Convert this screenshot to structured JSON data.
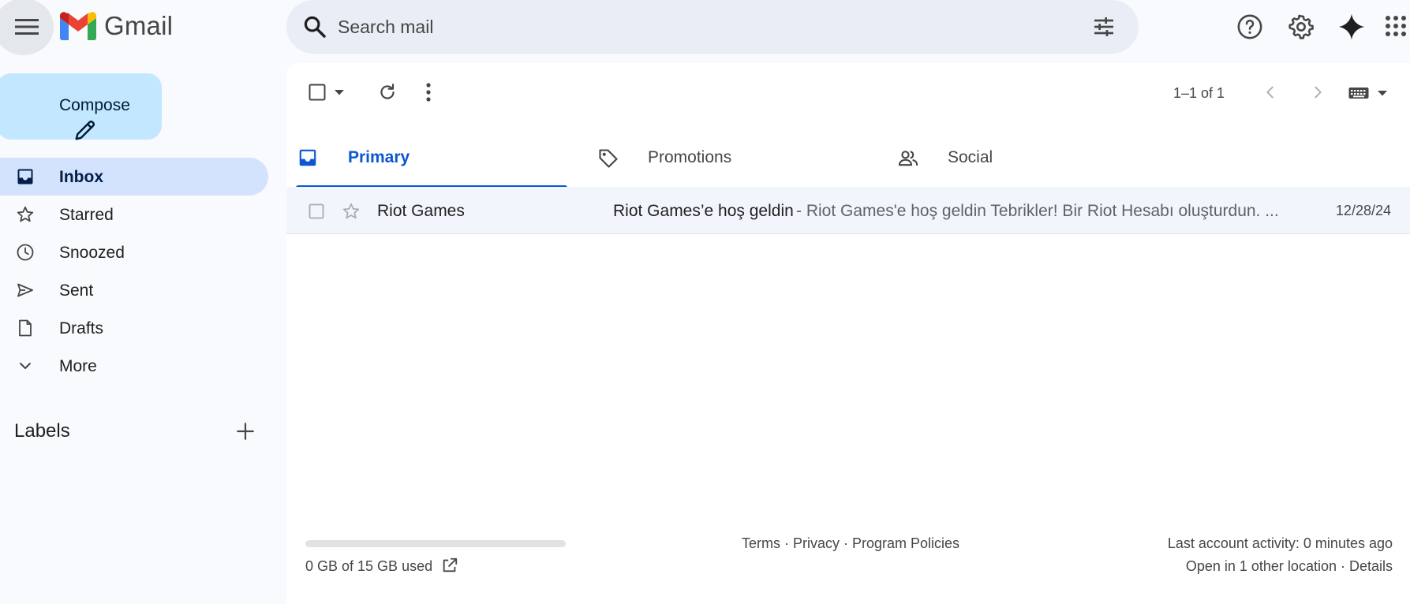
{
  "header": {
    "app_name": "Gmail",
    "search_placeholder": "Search mail",
    "icons": [
      "main-menu-icon",
      "search-icon",
      "search-options-icon",
      "help-icon",
      "settings-icon",
      "gemini-icon",
      "apps-icon"
    ]
  },
  "sidebar": {
    "compose_label": "Compose",
    "items": [
      {
        "label": "Inbox",
        "icon": "inbox-icon",
        "active": true
      },
      {
        "label": "Starred",
        "icon": "star-icon"
      },
      {
        "label": "Snoozed",
        "icon": "clock-icon"
      },
      {
        "label": "Sent",
        "icon": "send-icon"
      },
      {
        "label": "Drafts",
        "icon": "draft-icon"
      },
      {
        "label": "More",
        "icon": "chevron-down-icon"
      }
    ],
    "labels_heading": "Labels"
  },
  "toolbar": {
    "pagination": "1–1 of 1"
  },
  "tabs": [
    {
      "label": "Primary",
      "icon": "inbox-tab-icon",
      "active": true
    },
    {
      "label": "Promotions",
      "icon": "tag-icon"
    },
    {
      "label": "Social",
      "icon": "people-icon"
    }
  ],
  "emails": [
    {
      "sender": "Riot Games",
      "subject": "Riot Games’e hoş geldin",
      "snippet": " - Riot Games'e hoş geldin Tebrikler! Bir Riot Hesabı oluşturdun. ...",
      "date": "12/28/24"
    }
  ],
  "footer": {
    "storage": "0 GB of 15 GB used",
    "storage_fraction": 0,
    "policies": "Terms · Privacy · Program Policies",
    "activity": "Last account activity: 0 minutes ago",
    "other_location": "Open in 1 other location · Details"
  },
  "colors": {
    "accent": "#0b57d0",
    "compose_bg": "#c2e7ff",
    "active_nav_bg": "#d3e3fd",
    "search_bg": "#e9eef6",
    "page_bg": "#f8fafd"
  }
}
